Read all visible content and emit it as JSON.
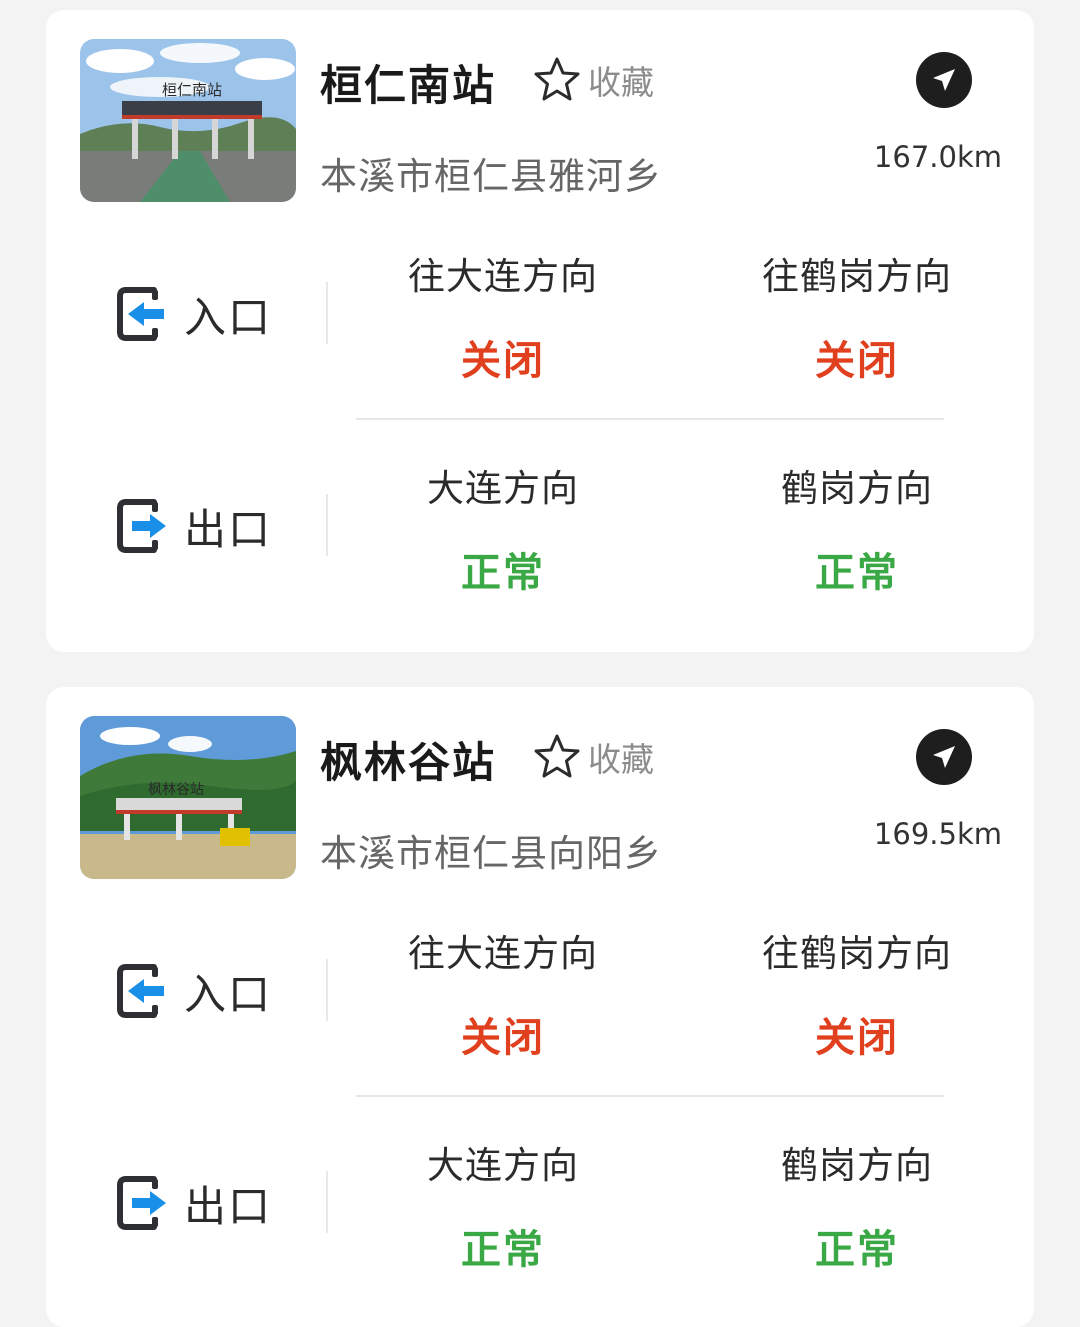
{
  "stations": [
    {
      "name": "桓仁南站",
      "favorite_label": "收藏",
      "address": "本溪市桓仁县雅河乡",
      "distance": "167.0km",
      "photo_text": "桓仁南站",
      "entrance": {
        "label": "入口",
        "directions": [
          {
            "name": "往大连方向",
            "status": "关闭"
          },
          {
            "name": "往鹤岗方向",
            "status": "关闭"
          }
        ]
      },
      "exit": {
        "label": "出口",
        "directions": [
          {
            "name": "大连方向",
            "status": "正常"
          },
          {
            "name": "鹤岗方向",
            "status": "正常"
          }
        ]
      }
    },
    {
      "name": "枫林谷站",
      "favorite_label": "收藏",
      "address": "本溪市桓仁县向阳乡",
      "distance": "169.5km",
      "photo_text": "枫林谷站",
      "entrance": {
        "label": "入口",
        "directions": [
          {
            "name": "往大连方向",
            "status": "关闭"
          },
          {
            "name": "往鹤岗方向",
            "status": "关闭"
          }
        ]
      },
      "exit": {
        "label": "出口",
        "directions": [
          {
            "name": "大连方向",
            "status": "正常"
          },
          {
            "name": "鹤岗方向",
            "status": "正常"
          }
        ]
      }
    }
  ],
  "colors": {
    "closed": "#e0401e",
    "normal": "#3aa845",
    "icon_accent": "#1a8fe8",
    "icon_frame": "#2d2f33"
  },
  "icons": {
    "favorite": "star-outline-icon",
    "navigate": "navigation-arrow-icon",
    "entrance": "entrance-arrow-icon",
    "exit": "exit-arrow-icon"
  }
}
